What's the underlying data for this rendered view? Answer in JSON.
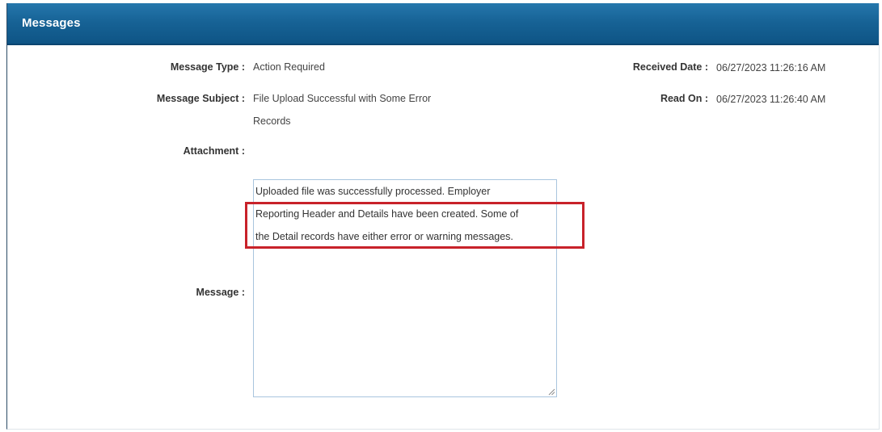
{
  "panel": {
    "title": "Messages"
  },
  "fields": {
    "message_type": {
      "label": "Message Type :",
      "value": "Action Required"
    },
    "message_subject": {
      "label": "Message Subject :",
      "value_line1": "File Upload Successful with Some Error",
      "value_line2": "Records"
    },
    "attachment": {
      "label": "Attachment :"
    },
    "message": {
      "label": "Message :",
      "lines": [
        "Uploaded file was successfully processed. Employer",
        "Reporting Header and Details have been created. Some of",
        "the Detail records have either error or warning messages."
      ]
    },
    "received_date": {
      "label": "Received Date :",
      "value": "06/27/2023 11:26:16 AM"
    },
    "read_on": {
      "label": "Read On :",
      "value": "06/27/2023 11:26:40 AM"
    }
  },
  "colors": {
    "header": "#176396",
    "highlight": "#c8222a",
    "textarea_border": "#a9c5de"
  }
}
